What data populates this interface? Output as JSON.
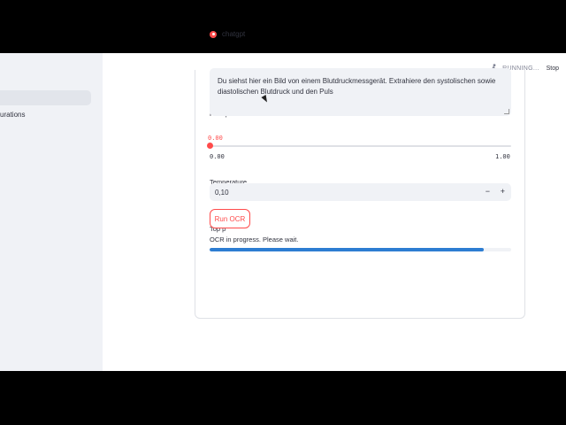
{
  "topbar": {
    "status": "RUNNING...",
    "stop_label": "Stop"
  },
  "sidebar": {
    "items": [
      {
        "label": ""
      },
      {
        "label": "urations"
      }
    ]
  },
  "model": {
    "selected": "chatgpt"
  },
  "prompt": {
    "label": "Prompt",
    "value": "Du siehst hier ein Bild von einem Blutdruckmessgerät. Extrahiere den systolischen sowie diastolischen Blutdruck und den Puls"
  },
  "temperature": {
    "label": "Temperature",
    "value": "0.00",
    "min": "0.00",
    "max": "1.00"
  },
  "top_p": {
    "label": "Top p",
    "value": "0,10",
    "minus": "−",
    "plus": "+"
  },
  "run_button": {
    "label": "Run OCR"
  },
  "progress": {
    "text": "OCR in progress. Please wait.",
    "fraction": 0.91
  },
  "colors": {
    "accent": "#ff4b4b",
    "progress": "#2d7dd2",
    "sidebar": "#f0f2f6"
  }
}
